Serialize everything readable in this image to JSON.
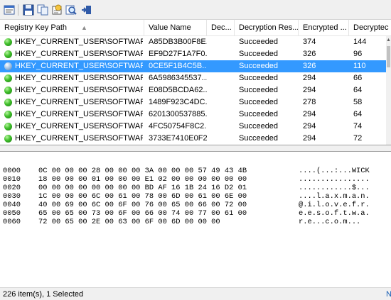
{
  "toolbar": {
    "buttons": [
      {
        "icon": "properties-icon"
      },
      {
        "icon": "save-icon"
      },
      {
        "icon": "copy-icon"
      },
      {
        "icon": "html-report-icon"
      },
      {
        "icon": "find-icon"
      },
      {
        "icon": "exit-icon"
      }
    ]
  },
  "columns": [
    {
      "label": "Registry Key Path",
      "sort": "▲"
    },
    {
      "label": "Value Name"
    },
    {
      "label": "Dec..."
    },
    {
      "label": "Decryption Res..."
    },
    {
      "label": "Encrypted ..."
    },
    {
      "label": "Decryptec"
    }
  ],
  "rows": [
    {
      "path": "HKEY_CURRENT_USER\\SOFTWARE\\...",
      "value_name": "A85DB3B00F8E...",
      "dec": "",
      "result": "Succeeded",
      "encrypted": "374",
      "decrypted": "144",
      "selected": false
    },
    {
      "path": "HKEY_CURRENT_USER\\SOFTWARE\\...",
      "value_name": "EF9D27F1A7F0...",
      "dec": "",
      "result": "Succeeded",
      "encrypted": "326",
      "decrypted": "96",
      "selected": false
    },
    {
      "path": "HKEY_CURRENT_USER\\SOFTWARE\\...",
      "value_name": "0CE5F1B4C5B...",
      "dec": "",
      "result": "Succeeded",
      "encrypted": "326",
      "decrypted": "110",
      "selected": true
    },
    {
      "path": "HKEY_CURRENT_USER\\SOFTWARE\\...",
      "value_name": "6A5986345537...",
      "dec": "",
      "result": "Succeeded",
      "encrypted": "294",
      "decrypted": "66",
      "selected": false
    },
    {
      "path": "HKEY_CURRENT_USER\\SOFTWARE\\...",
      "value_name": "E08D5BCDA62...",
      "dec": "",
      "result": "Succeeded",
      "encrypted": "294",
      "decrypted": "64",
      "selected": false
    },
    {
      "path": "HKEY_CURRENT_USER\\SOFTWARE\\...",
      "value_name": "1489F923C4DC...",
      "dec": "",
      "result": "Succeeded",
      "encrypted": "278",
      "decrypted": "58",
      "selected": false
    },
    {
      "path": "HKEY_CURRENT_USER\\SOFTWARE\\...",
      "value_name": "6201300537885...",
      "dec": "",
      "result": "Succeeded",
      "encrypted": "294",
      "decrypted": "64",
      "selected": false
    },
    {
      "path": "HKEY_CURRENT_USER\\SOFTWARE\\...",
      "value_name": "4FC50754F8C2...",
      "dec": "",
      "result": "Succeeded",
      "encrypted": "294",
      "decrypted": "74",
      "selected": false
    },
    {
      "path": "HKEY_CURRENT_USER\\SOFTWARE\\...",
      "value_name": "3733E7410E0F2...",
      "dec": "",
      "result": "Succeeded",
      "encrypted": "294",
      "decrypted": "72",
      "selected": false
    }
  ],
  "hex": [
    {
      "offset": "0000",
      "bytes": "0C 00 00 00 28 00 00 00 3A 00 00 00 57 49 43 4B",
      "ascii": "....(...:...WICK"
    },
    {
      "offset": "0010",
      "bytes": "18 00 00 00 01 00 00 00 E1 02 00 00 00 00 00 00",
      "ascii": "................"
    },
    {
      "offset": "0020",
      "bytes": "00 00 00 00 00 00 00 00 BD AF 16 1B 24 16 D2 01",
      "ascii": "............$..."
    },
    {
      "offset": "0030",
      "bytes": "1C 00 00 00 6C 00 61 00 78 00 6D 00 61 00 6E 00",
      "ascii": "....l.a.x.m.a.n."
    },
    {
      "offset": "0040",
      "bytes": "40 00 69 00 6C 00 6F 00 76 00 65 00 66 00 72 00",
      "ascii": "@.i.l.o.v.e.f.r."
    },
    {
      "offset": "0050",
      "bytes": "65 00 65 00 73 00 6F 00 66 00 74 00 77 00 61 00",
      "ascii": "e.e.s.o.f.t.w.a."
    },
    {
      "offset": "0060",
      "bytes": "72 00 65 00 2E 00 63 00 6F 00 6D 00 00 00",
      "ascii": "r.e...c.o.m..."
    }
  ],
  "status": {
    "text": "226 item(s), 1 Selected",
    "link": "N"
  },
  "colors": {
    "selection": "#3399ff",
    "status_icon": "#3fbf2a"
  }
}
